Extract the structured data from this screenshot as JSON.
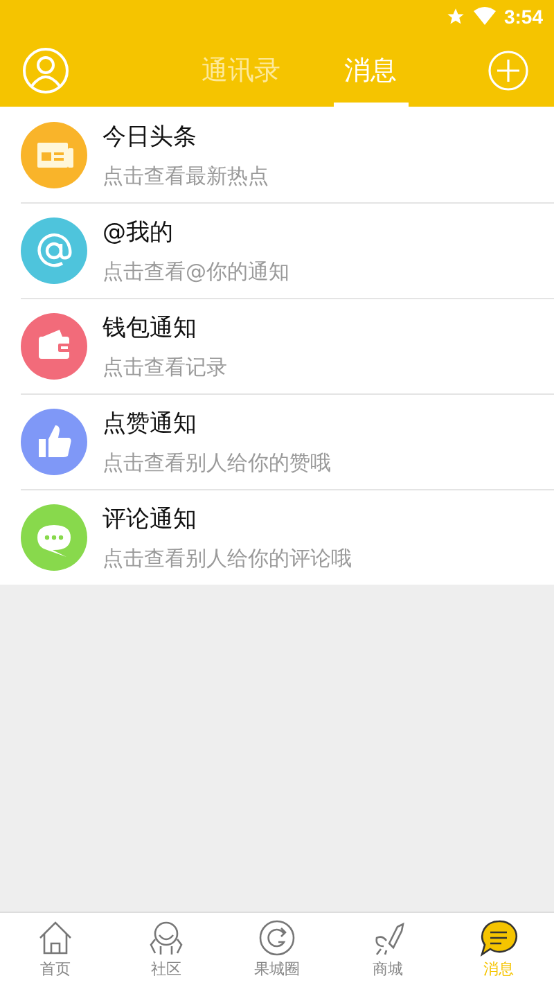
{
  "status_bar": {
    "time": "3:54"
  },
  "header": {
    "tabs": [
      {
        "label": "通讯录",
        "selected": false
      },
      {
        "label": "消息",
        "selected": true
      }
    ]
  },
  "messages": [
    {
      "kind": "news",
      "color": "#f9b42a",
      "title": "今日头条",
      "subtitle": "点击查看最新热点"
    },
    {
      "kind": "mention",
      "color": "#4ec4dc",
      "title": "@我的",
      "subtitle": "点击查看@你的通知"
    },
    {
      "kind": "wallet",
      "color": "#f26b7a",
      "title": "钱包通知",
      "subtitle": "点击查看记录"
    },
    {
      "kind": "like",
      "color": "#7f98f7",
      "title": "点赞通知",
      "subtitle": "点击查看别人给你的赞哦"
    },
    {
      "kind": "comment",
      "color": "#88d94c",
      "title": "评论通知",
      "subtitle": "点击查看别人给你的评论哦"
    }
  ],
  "bottom_nav": [
    {
      "kind": "home",
      "label": "首页",
      "selected": false
    },
    {
      "kind": "community",
      "label": "社区",
      "selected": false
    },
    {
      "kind": "circle",
      "label": "果城圈",
      "selected": false
    },
    {
      "kind": "shop",
      "label": "商城",
      "selected": false
    },
    {
      "kind": "message",
      "label": "消息",
      "selected": true
    }
  ]
}
